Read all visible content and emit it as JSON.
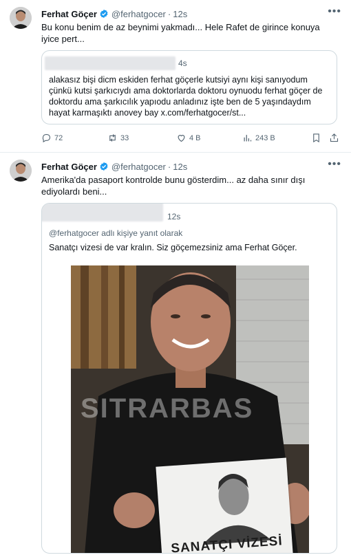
{
  "tweets": [
    {
      "author": "Ferhat Göçer",
      "handle": "@ferhatgocer",
      "dot": "·",
      "time": "12s",
      "text": "Bu konu benim de az beynimi yakmadı... Hele Rafet de girince konuya iyice pert...",
      "quote": {
        "time": "4s",
        "text": "alakasız bişi dicm eskiden ferhat göçerle kutsiyi aynı kişi sanıyodum çünkü kutsi şarkıcıydı ama doktorlarda doktoru oynuodu ferhat göçer de doktordu ama şarkıcılık yapıodu anladınız işte ben de 5 yaşındaydım hayat karmaşıktı anovey bay x.com/ferhatgocer/st..."
      },
      "stats": {
        "replies": "72",
        "retweets": "33",
        "likes": "4 B",
        "views": "243 B"
      }
    },
    {
      "author": "Ferhat Göçer",
      "handle": "@ferhatgocer",
      "dot": "·",
      "time": "12s",
      "text": "Amerika'da pasaport kontrolde bunu gösterdim... az daha sınır dışı ediyolardı beni...",
      "quote": {
        "time": "12s",
        "reply_to": "@ferhatgocer adlı kişiye yanıt olarak",
        "text": "Sanatçı vizesi de var kralın. Siz göçemezsiniz ama Ferhat Göçer.",
        "image_watermark": "SITRARBAS",
        "sign_text": "SANATÇI VİZESİ"
      }
    }
  ],
  "icons": {
    "verified": "verified-badge-icon",
    "more": "more-icon",
    "reply": "reply-icon",
    "retweet": "retweet-icon",
    "like": "heart-icon",
    "views": "views-icon",
    "bookmark": "bookmark-icon",
    "share": "share-icon"
  },
  "colors": {
    "verified": "#1d9bf0",
    "muted": "#536471",
    "border": "#cfd9de"
  }
}
